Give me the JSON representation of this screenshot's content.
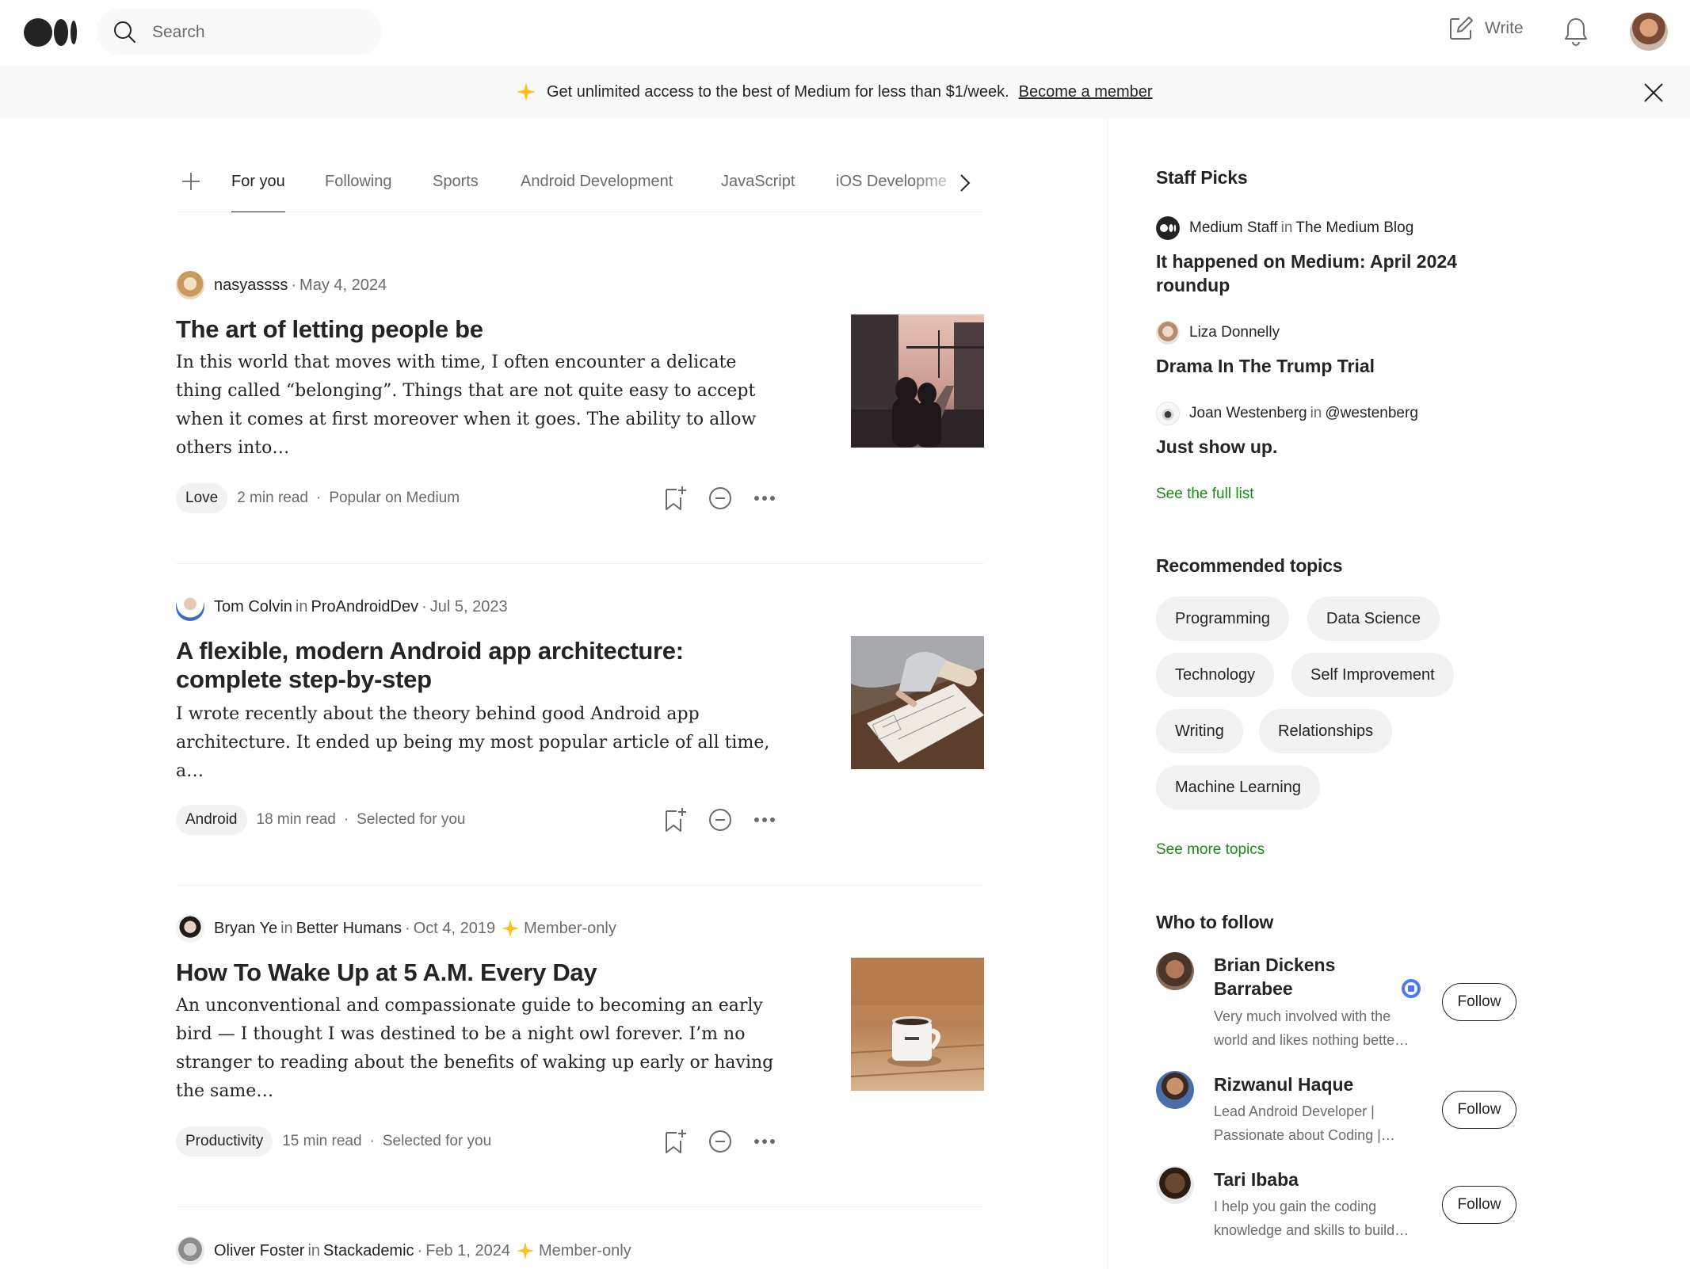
{
  "header": {
    "search_placeholder": "Search",
    "write_label": "Write"
  },
  "banner": {
    "text": "Get unlimited access to the best of Medium for less than $1/week.",
    "link": "Become a member"
  },
  "tabs": [
    "For you",
    "Following",
    "Sports",
    "Android Development",
    "JavaScript",
    "iOS Developme"
  ],
  "articles": [
    {
      "author": "nasyassss",
      "publication": "",
      "date": "May 4, 2024",
      "member_only": "",
      "title": "The art of letting people be",
      "subtitle": "In this world that moves with time, I often encounter a delicate thing called “belonging”. Things that are not quite easy to accept when it comes at first moreover when it goes. The ability to allow others into…",
      "tag": "Love",
      "read_time": "2 min read",
      "reason": "Popular on Medium"
    },
    {
      "author": "Tom Colvin",
      "publication": "ProAndroidDev",
      "date": "Jul 5, 2023",
      "member_only": "",
      "title": "A flexible, modern Android app architecture: complete step-by-step",
      "subtitle": "I wrote recently about the theory behind good Android app architecture. It ended up being my most popular article of all time, a…",
      "tag": "Android",
      "read_time": "18 min read",
      "reason": "Selected for you"
    },
    {
      "author": "Bryan Ye",
      "publication": "Better Humans",
      "date": "Oct 4, 2019",
      "member_only": "Member-only",
      "title": "How To Wake Up at 5 A.M. Every Day",
      "subtitle": "An unconventional and compassionate guide to becoming an early bird — I thought I was destined to be a night owl forever. I’m no stranger to reading about the benefits of waking up early or having the same…",
      "tag": "Productivity",
      "read_time": "15 min read",
      "reason": "Selected for you"
    },
    {
      "author": "Oliver Foster",
      "publication": "Stackademic",
      "date": "Feb 1, 2024",
      "member_only": "Member-only"
    }
  ],
  "sidebar": {
    "staff_picks_heading": "Staff Picks",
    "picks": [
      {
        "author": "Medium Staff",
        "in": "in",
        "publication": "The Medium Blog",
        "title": "It happened on Medium: April 2024 roundup"
      },
      {
        "author": "Liza Donnelly",
        "in": "",
        "publication": "",
        "title": "Drama In The Trump Trial"
      },
      {
        "author": "Joan Westenberg",
        "in": "in",
        "publication": "@westenberg",
        "title": "Just show up."
      }
    ],
    "see_full_list": "See the full list",
    "topics_heading": "Recommended topics",
    "topics": [
      "Programming",
      "Data Science",
      "Technology",
      "Self Improvement",
      "Writing",
      "Relationships",
      "Machine Learning"
    ],
    "see_more_topics": "See more topics",
    "follow_heading": "Who to follow",
    "follow": [
      {
        "name": "Brian Dickens Barrabee",
        "bio": "Very much involved with the world and likes nothing bette…",
        "button": "Follow"
      },
      {
        "name": "Rizwanul Haque",
        "bio": "Lead Android Developer | Passionate about Coding |…",
        "button": "Follow"
      },
      {
        "name": "Tari Ibaba",
        "bio": "I help you gain the coding knowledge and skills to build…",
        "button": "Follow"
      }
    ]
  },
  "colors": {
    "accent_green": "#1a8917",
    "star_yellow": "#ffc017",
    "text": "#242424",
    "muted": "#6b6b6b"
  },
  "icons": [
    "medium-logo-icon",
    "search-icon",
    "write-icon",
    "bell-icon",
    "sparkle-icon",
    "close-icon",
    "plus-icon",
    "chevron-right-icon",
    "bookmark-add-icon",
    "show-less-icon",
    "more-icon",
    "verified-badge-icon"
  ]
}
